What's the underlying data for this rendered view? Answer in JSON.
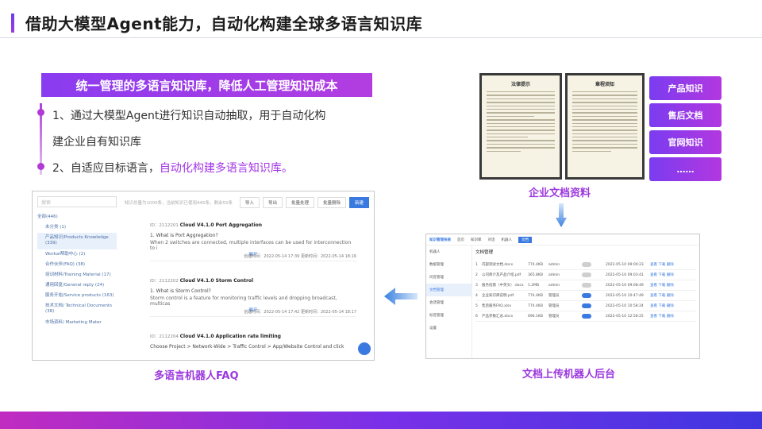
{
  "header": {
    "title": "借助大模型Agent能力，自动化构建全球多语言知识库"
  },
  "banner": {
    "text": "统一管理的多语言知识库，降低人工管理知识成本"
  },
  "points": [
    {
      "line1": "1、通过大模型Agent进行知识自动抽取，用于自动化构",
      "line2": "建企业自有知识库"
    },
    {
      "plain": "2、自适应目标语言，",
      "highlight": "自动化构建多语言知识库。"
    }
  ],
  "docs": {
    "page1_title": "法律提示",
    "page2_title": "章程须知",
    "categories": [
      "产品知识",
      "售后文档",
      "官网知识",
      "……"
    ],
    "caption": "企业文档资料"
  },
  "faq": {
    "caption": "多语言机器人FAQ",
    "search_placeholder": "搜索",
    "stats": "知识总量为1000条，当前知识已使用445条，剩余55条",
    "buttons": [
      "导入",
      "导出",
      "批量处理",
      "批量删除",
      "新建"
    ],
    "tree": [
      "全部(446)",
      "未分类 (1)",
      "产品知识/Products Knowledge (339)",
      "Workai帮助中心 (2)",
      "合作伙伴(FAQ) (38)",
      "培训材料/Training Material (17)",
      "通用回复/General reply (24)",
      "服务开始/Service products (163)",
      "技术文档/ Technical Documents (38)",
      "市场资料/ Marketing Mater"
    ],
    "cards": [
      {
        "id": "ID：2112201",
        "title": "Cloud V4.1.0 Port Aggregation",
        "q": "1. What is Port Aggregation?",
        "a": "When 2 switches are connected, multiple interfaces can be used for interconnection to i",
        "more": "展开",
        "created": "创建时间：2022-05-14 17:39",
        "updated": "更新时间：2022-05-14 18:16"
      },
      {
        "id": "ID：2112202",
        "title": "Cloud V4.1.0 Storm Control",
        "q": "1. What is Storm Control?",
        "a": "Storm control is a feature for monitoring traffic levels and dropping broadcast, multicas",
        "more": "展开",
        "created": "创建时间：2022-05-14 17:42",
        "updated": "更新时间：2022-05-14 18:17"
      },
      {
        "id": "ID：2112204",
        "title": "Cloud V4.1.0 Application rate limiting",
        "q": "Choose Project > Network-Wide > Traffic Control > App/Website Control and click",
        "a": "",
        "more": "",
        "created": "",
        "updated": ""
      }
    ]
  },
  "upload": {
    "caption": "文档上传机器人后台",
    "app_name": "知识管理系统",
    "tabs": [
      "首页",
      "知识库",
      "对话",
      "机器人",
      "文档"
    ],
    "side": [
      "机器人",
      "数据管理",
      "问答管理",
      "文档管理",
      "会话管理",
      "标签管理",
      "设置"
    ],
    "heading": "文档管理",
    "rows": [
      {
        "no": "1",
        "name": "内部测试文档.docx",
        "size": "774.4KB",
        "owner": "admin",
        "on": false,
        "date": "2022-05-10 09:00:23"
      },
      {
        "no": "2",
        "name": "公司简介及产品介绍.pdf",
        "size": "365.8KB",
        "owner": "admin",
        "on": false,
        "date": "2022-05-10 09:03:41"
      },
      {
        "no": "3",
        "name": "服务指南（中英文）.docx",
        "size": "1.2MB",
        "owner": "admin",
        "on": false,
        "date": "2022-05-10 09:08:49"
      },
      {
        "no": "4",
        "name": "企业知识库说明.pdf",
        "size": "774.4KB",
        "owner": "管理员",
        "on": true,
        "date": "2022-05-10 10:47:49"
      },
      {
        "no": "5",
        "name": "售后服务FAQ.xlsx",
        "size": "774.4KB",
        "owner": "管理员",
        "on": true,
        "date": "2022-05-10 10:58:24"
      },
      {
        "no": "6",
        "name": "产品参数汇总.docx",
        "size": "696.1KB",
        "owner": "管理员",
        "on": true,
        "date": "2022-05-10 12:58:25"
      }
    ],
    "ops": "查看 下载 删除"
  },
  "colors": {
    "accent": "#9b38de",
    "banner_start": "#8a3cf0",
    "banner_end": "#b33de0",
    "link": "#3a7ae0"
  }
}
